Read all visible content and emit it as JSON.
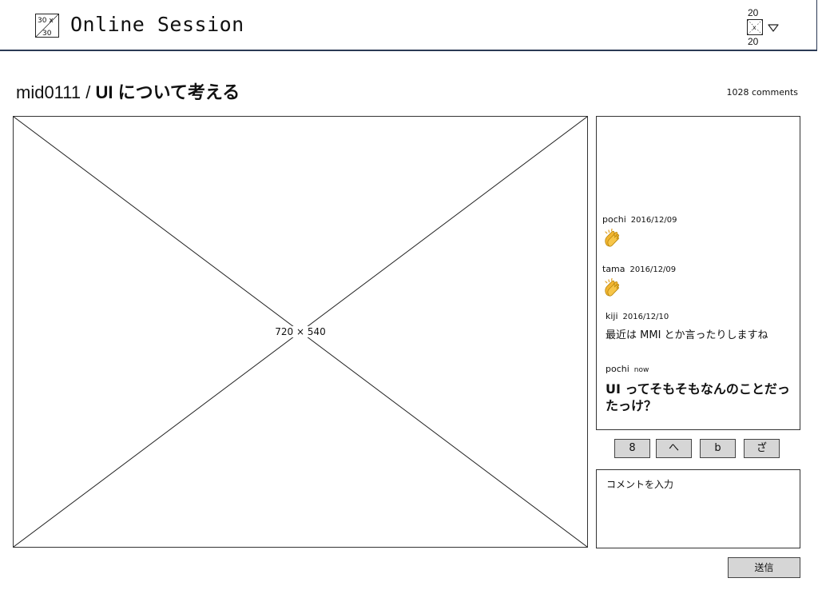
{
  "header": {
    "logo": {
      "icon": "image-placeholder-icon",
      "label_top": "30 x",
      "label_bottom": "30"
    },
    "app_title": "Online Session",
    "user": {
      "avatar_icon": "image-placeholder-icon",
      "avatar_label_top": "20",
      "avatar_label_bottom": "20",
      "menu_icon": "triangle-down-icon"
    }
  },
  "session": {
    "room": "mid0111",
    "separator": " / ",
    "title": "UI について考える",
    "comment_count": "1028 comments"
  },
  "video": {
    "placeholder_label": "720 × 540"
  },
  "comments": [
    {
      "author": "pochi",
      "date": "2016/12/09",
      "type": "clap",
      "icon": "clapping-hands-icon"
    },
    {
      "author": "tama",
      "date": "2016/12/09",
      "type": "clap",
      "icon": "clapping-hands-icon"
    },
    {
      "author": "kiji",
      "date": "2016/12/10",
      "type": "text",
      "body": "最近は MMI とか言ったりしますね"
    },
    {
      "author": "pochi",
      "date": "now",
      "type": "text-large",
      "body": "UI ってそもそもなんのことだったっけ？"
    }
  ],
  "reactions": [
    "8",
    "へ",
    "b",
    "ざ"
  ],
  "input": {
    "placeholder": "コメントを入力",
    "value": ""
  },
  "send_label": "送信",
  "colors": {
    "header_border": "#2b3a55",
    "button_bg": "#d6d6d6",
    "clap": "#f2b531"
  }
}
